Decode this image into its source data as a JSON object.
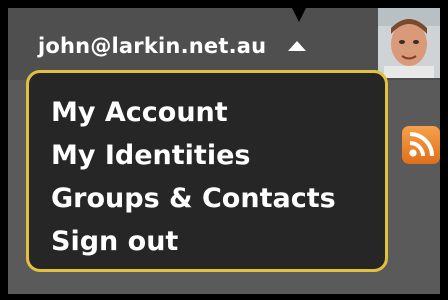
{
  "header": {
    "account_email": "john@larkin.net.au",
    "caret_icon": "caret-up-icon",
    "avatar_icon": "user-avatar"
  },
  "menu": {
    "items": [
      {
        "label": "My Account"
      },
      {
        "label": "My Identities"
      },
      {
        "label": "Groups & Contacts"
      },
      {
        "label": "Sign out"
      }
    ]
  },
  "side": {
    "rss_icon": "rss-feed-icon"
  },
  "colors": {
    "dropdown_border": "#e3c13f",
    "dropdown_bg": "#262626",
    "bar_bg": "#4f4f4f",
    "rss": "#f08a2a"
  }
}
